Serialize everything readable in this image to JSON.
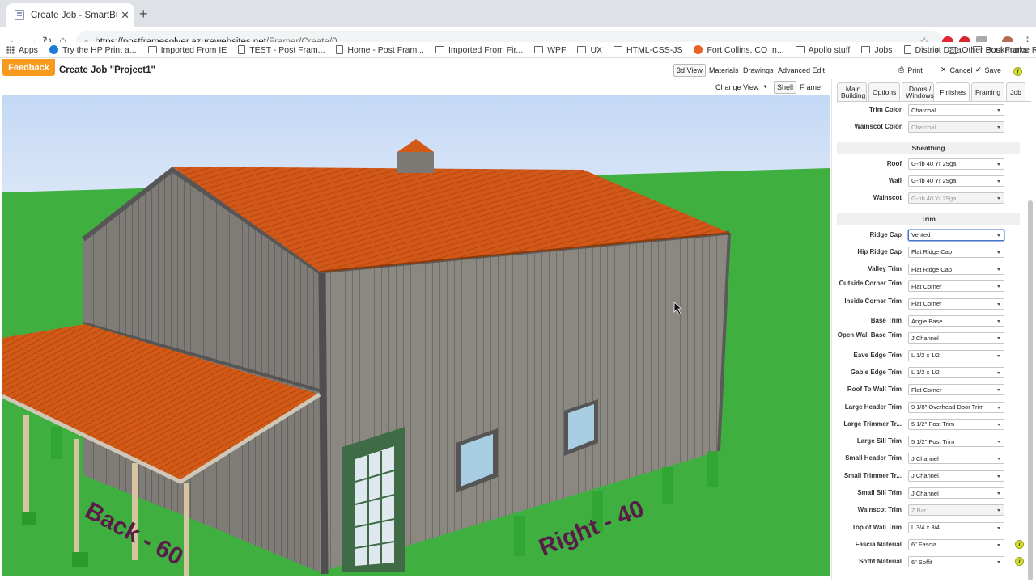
{
  "browser": {
    "tab_title": "Create Job - SmartBuild Frame",
    "url_host": "https://postframesolver.azurewebsites.net",
    "url_path": "/Framer/Create/0",
    "bookmarks": [
      {
        "label": "Apps",
        "icon": "apps-grid-icon"
      },
      {
        "label": "Try the HP Print a...",
        "icon": "hp-icon"
      },
      {
        "label": "Imported From IE",
        "icon": "folder-icon"
      },
      {
        "label": "TEST - Post Fram...",
        "icon": "page-icon"
      },
      {
        "label": "Home - Post Fram...",
        "icon": "page-icon"
      },
      {
        "label": "Imported From Fir...",
        "icon": "folder-icon"
      },
      {
        "label": "WPF",
        "icon": "folder-icon"
      },
      {
        "label": "UX",
        "icon": "folder-icon"
      },
      {
        "label": "HTML-CSS-JS",
        "icon": "folder-icon"
      },
      {
        "label": "Fort Collins, CO In...",
        "icon": "ftc-icon"
      },
      {
        "label": "Apollo stuff",
        "icon": "folder-icon"
      },
      {
        "label": "Jobs",
        "icon": "folder-icon"
      },
      {
        "label": "District Data",
        "icon": "page-icon"
      },
      {
        "label": "Post Frame Resou...",
        "icon": "folder-icon"
      }
    ],
    "other_bookmarks": "Other Bookmarks"
  },
  "app": {
    "feedback": "Feedback",
    "title": "Create Job \"Project1\"",
    "view_buttons": {
      "view3d": "3d View",
      "materials": "Materials",
      "drawings": "Drawings",
      "advanced_edit": "Advanced Edit",
      "change_view": "Change View",
      "shell": "Shell",
      "frame": "Frame"
    },
    "actions": {
      "print": "Print",
      "cancel": "Cancel",
      "save": "Save"
    }
  },
  "panel": {
    "tabs": [
      "Main Building",
      "Options",
      "Doors / Windows",
      "Finishes",
      "Framing",
      "Job"
    ],
    "active_tab": "Finishes",
    "top_fields": [
      {
        "label": "Trim Color",
        "value": "Charcoal",
        "disabled": false
      },
      {
        "label": "Wainscot Color",
        "value": "Charcoal",
        "disabled": true
      }
    ],
    "sheathing_title": "Sheathing",
    "sheathing_fields": [
      {
        "label": "Roof",
        "value": "G-rib 40 Yr 29ga",
        "disabled": false
      },
      {
        "label": "Wall",
        "value": "G-rib 40 Yr 29ga",
        "disabled": false
      },
      {
        "label": "Wainscot",
        "value": "G-rib 40 Yr 29ga",
        "disabled": true
      }
    ],
    "trim_title": "Trim",
    "trim_fields": [
      {
        "label": "Ridge Cap",
        "value": "Vented",
        "focused": true
      },
      {
        "label": "Hip Ridge Cap",
        "value": "Flat Ridge Cap"
      },
      {
        "label": "Valley Trim",
        "value": "Flat Ridge Cap"
      },
      {
        "label": "Outside Corner Trim",
        "value": "Flat Corner"
      },
      {
        "label": "Inside Corner Trim",
        "value": "Flat Corner"
      },
      {
        "label": "Base Trim",
        "value": "Angle Base"
      },
      {
        "label": "Open Wall Base Trim",
        "value": "J Channel"
      },
      {
        "label": "Eave Edge Trim",
        "value": "L 1/2 x 1/2"
      },
      {
        "label": "Gable Edge Trim",
        "value": "L 1/2 x 1/2"
      },
      {
        "label": "Roof To Wall Trim",
        "value": "Flat Corner"
      },
      {
        "label": "Large Header Trim",
        "value": "9 1/8\" Overhead Door Trim"
      },
      {
        "label": "Large Trimmer Tr...",
        "value": "5 1/2\" Post Trim"
      },
      {
        "label": "Large Sill Trim",
        "value": "5 1/2\" Post Trim"
      },
      {
        "label": "Small Header Trim",
        "value": "J Channel"
      },
      {
        "label": "Small Trimmer Tr...",
        "value": "J Channel"
      },
      {
        "label": "Small Sill Trim",
        "value": "J Channel"
      },
      {
        "label": "Wainscot Trim",
        "value": "Z Bar",
        "disabled": true
      },
      {
        "label": "Top of Wall Trim",
        "value": "L 3/4 x 3/4"
      },
      {
        "label": "Fascia Material",
        "value": "6\" Fascia",
        "info": true
      },
      {
        "label": "Soffit Material",
        "value": "6\" Soffit",
        "info": true
      }
    ]
  },
  "scene": {
    "ground_labels": [
      "Back - 60",
      "Right - 40"
    ],
    "colors": {
      "sky": "#c9dcf6",
      "grass": "#3fb23f",
      "roof": "#d35c14",
      "wall": "#8a8680",
      "trim": "#555555",
      "door": "#3d6b45",
      "window_glass": "#a9cde3",
      "accent": "#f79a1e"
    }
  }
}
